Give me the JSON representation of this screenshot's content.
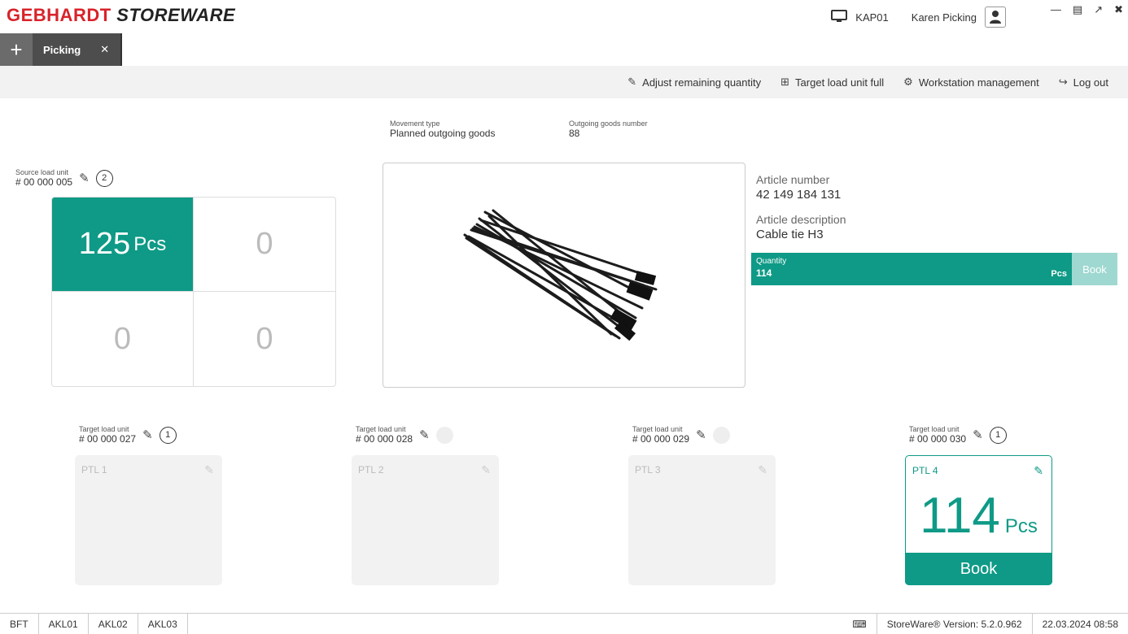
{
  "brand": {
    "part1": "GEBHARDT",
    "part2": "STOREWARE",
    "color": "#d8232a"
  },
  "header": {
    "workstation": "KAP01",
    "user": "Karen Picking"
  },
  "tabs": [
    {
      "label": "Picking"
    }
  ],
  "toolbar": {
    "adjust": "Adjust remaining quantity",
    "target_full": "Target load unit full",
    "workstation_mgmt": "Workstation management",
    "logout": "Log out"
  },
  "movement": {
    "label": "Movement type",
    "value": "Planned outgoing goods"
  },
  "outgoing": {
    "label": "Outgoing goods number",
    "value": "88"
  },
  "source": {
    "label": "Source load unit",
    "number": "# 00 000 005",
    "count": "2",
    "cells": [
      {
        "value": "125",
        "unit": "Pcs"
      },
      {
        "value": "0"
      },
      {
        "value": "0"
      },
      {
        "value": "0"
      }
    ]
  },
  "article": {
    "number_label": "Article number",
    "number": "42 149 184 131",
    "desc_label": "Article description",
    "desc": "Cable tie H3"
  },
  "quantity": {
    "label": "Quantity",
    "value": "114",
    "unit": "Pcs",
    "book": "Book"
  },
  "targets": [
    {
      "label": "Target load unit",
      "number": "# 00 000 027",
      "count": "1",
      "ptl": "PTL 1"
    },
    {
      "label": "Target load unit",
      "number": "# 00 000 028",
      "count": "",
      "ptl": "PTL 2"
    },
    {
      "label": "Target load unit",
      "number": "# 00 000 029",
      "count": "",
      "ptl": "PTL 3"
    },
    {
      "label": "Target load unit",
      "number": "# 00 000 030",
      "count": "1",
      "ptl": "PTL 4",
      "qty": "114",
      "unit": "Pcs",
      "book": "Book"
    }
  ],
  "statusbar": {
    "items": [
      "BFT",
      "AKL01",
      "AKL02",
      "AKL03"
    ],
    "version": "StoreWare® Version: 5.2.0.962",
    "datetime": "22.03.2024 08:58"
  },
  "colors": {
    "accent": "#0e9a86",
    "accent_light": "#9fd8d0"
  }
}
